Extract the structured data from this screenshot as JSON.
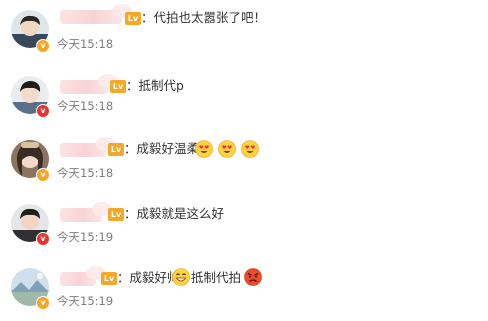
{
  "comments": [
    {
      "text": "：代拍也太嚣张了吧！",
      "time": "今天15:18",
      "level_badge": "Lv",
      "verified_badge": "v",
      "avatar": "avatar-boy-icon"
    },
    {
      "text": "：抵制代p",
      "time": "今天15:18",
      "level_badge": "Lv",
      "verified_badge": "v",
      "avatar": "avatar-boy-icon"
    },
    {
      "text": "：成毅好温柔",
      "time": "今天15:18",
      "level_badge": "Lv",
      "verified_badge": "v",
      "avatar": "avatar-girl-icon",
      "emojis": [
        "heart-eyes-emoji",
        "heart-eyes-emoji",
        "heart-eyes-emoji"
      ]
    },
    {
      "text": "：成毅就是这么好",
      "time": "今天15:19",
      "level_badge": "Lv",
      "verified_badge": "v",
      "avatar": "avatar-boy-icon"
    },
    {
      "text_before": "：成毅好帅",
      "text_after": "抵制代拍",
      "time": "今天15:19",
      "level_badge": "Lv",
      "verified_badge": "v",
      "avatar": "avatar-landscape-icon",
      "emojis": [
        "grin-emoji",
        "angry-emoji"
      ]
    }
  ],
  "colors": {
    "text": "#333333",
    "time": "#7d7d7d",
    "level_badge": "#f4a82a",
    "verified_badge": "#f5a623",
    "username_redacted": "#f8d3d6"
  }
}
